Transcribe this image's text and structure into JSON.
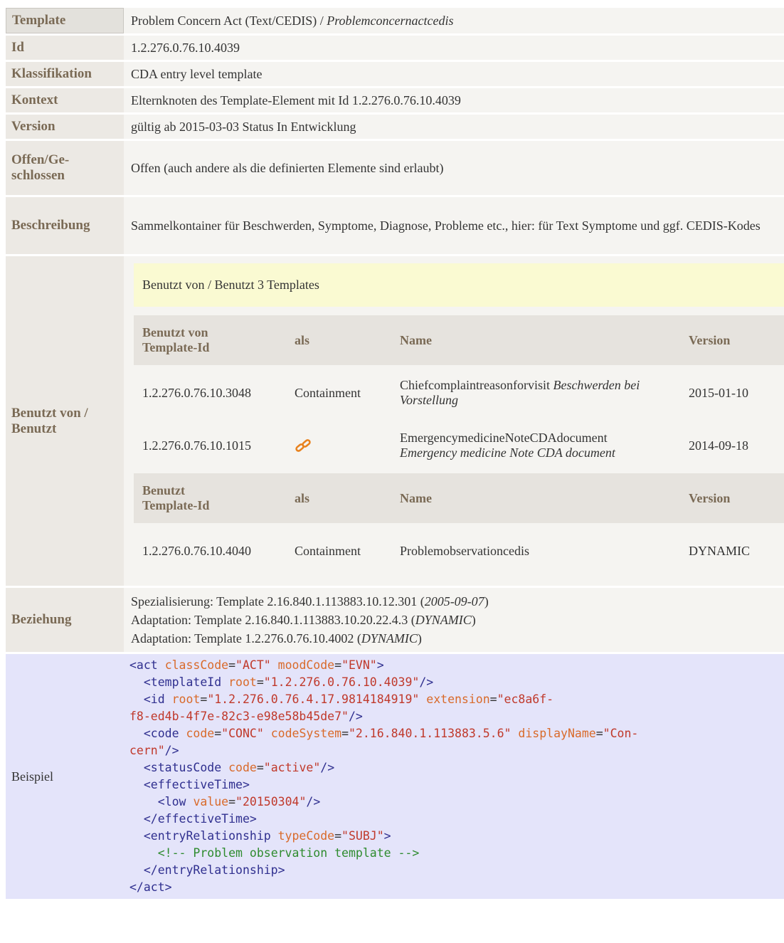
{
  "rows": {
    "template": {
      "label": "Template",
      "value": "Problem Concern Act (Text/CEDIS) / ",
      "value_italic": "Problemconcernactcedis"
    },
    "id": {
      "label": "Id",
      "value": "1.2.276.0.76.10.4039"
    },
    "klassifikation": {
      "label": "Klassifikation",
      "value": "CDA entry level template"
    },
    "kontext": {
      "label": "Kontext",
      "value": "Elternknoten des Template-Element mit Id 1.2.276.0.76.10.4039"
    },
    "version": {
      "label": "Version",
      "value": "gültig ab 2015-03-03 Status In Entwicklung"
    },
    "offen": {
      "label_line1": "Offen/Ge-",
      "label_line2": "schlossen",
      "value": "Offen (auch andere als die definierten Elemente sind erlaubt)"
    },
    "beschreibung": {
      "label": "Beschreibung",
      "value": "Sammelkontainer für Beschwerden, Symptome, Diagnose, Probleme etc., hier: für Text Symptome und ggf. CEDIS-Kodes"
    },
    "benutzt": {
      "label_line1": "Benutzt von /",
      "label_line2": "Benutzt"
    },
    "beziehung": {
      "label": "Beziehung",
      "lines": [
        {
          "text": "Spezialisierung: Template 2.16.840.1.113883.10.12.301 (",
          "italic": "2005-09-07",
          "end": ")"
        },
        {
          "text": "Adaptation: Template 2.16.840.1.113883.10.20.22.4.3 (",
          "italic": "DYNAMIC",
          "end": ")"
        },
        {
          "text": "Adaptation: Template 1.2.276.0.76.10.4002 (",
          "italic": "DYNAMIC",
          "end": ")"
        }
      ]
    },
    "beispiel": {
      "label": "Beispiel"
    }
  },
  "usage": {
    "header": "Benutzt von / Benutzt 3 Templates",
    "used_by_headers": {
      "id_line1": "Benutzt von",
      "id_line2": "Template-Id",
      "als": "als",
      "name": "Name",
      "version": "Version"
    },
    "used_by": [
      {
        "id": "1.2.276.0.76.10.3048",
        "als": "Containment",
        "name": "Chiefcomplaintreasonforvisit ",
        "name_italic": "Beschwerden bei Vorstellung",
        "version": "2015-01-10"
      },
      {
        "id": "1.2.276.0.76.10.1015",
        "als_icon": "chain-link-icon",
        "name": "EmergencymedicineNoteCDAdocument",
        "name_italic": "Emergency medicine Note CDA document",
        "version": "2014-09-18"
      }
    ],
    "uses_headers": {
      "id_line1": "Benutzt",
      "id_line2": "Template-Id",
      "als": "als",
      "name": "Name",
      "version": "Version"
    },
    "uses": [
      {
        "id": "1.2.276.0.76.10.4040",
        "als": "Containment",
        "name": "Problemobservationcedis",
        "version": "DYNAMIC"
      }
    ]
  },
  "colors": {
    "label_text": "#7a6a55",
    "example_bg": "#E4E4FA",
    "usage_header_bg": "#FAFAD2",
    "link_icon": "#E8821E"
  }
}
